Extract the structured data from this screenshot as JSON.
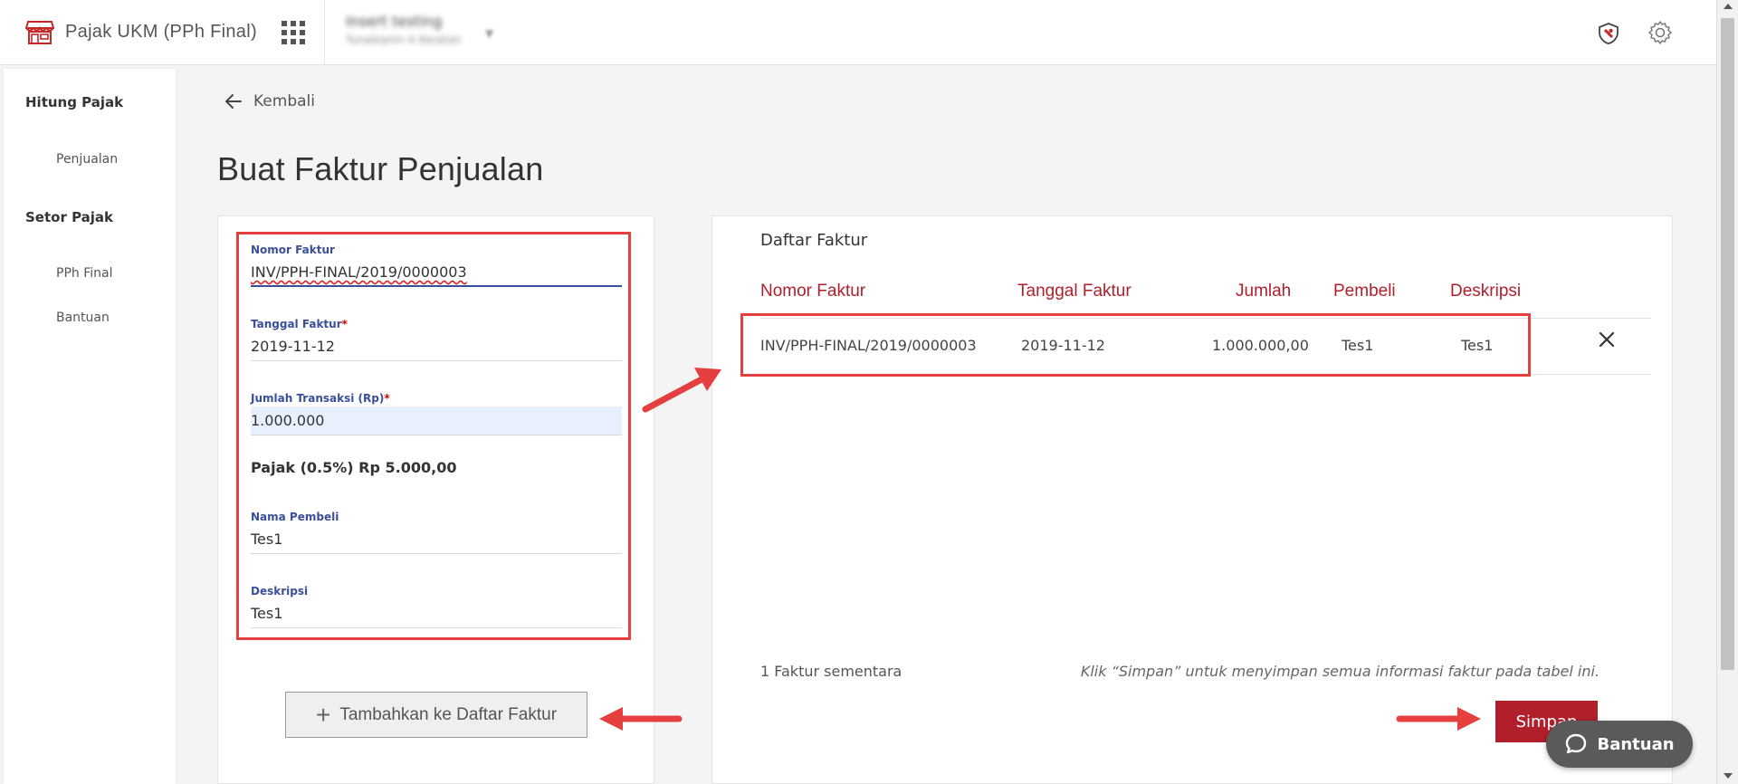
{
  "header": {
    "app_title": "Pajak UKM (PPh Final)",
    "user_name": "Insert testing",
    "user_sub": "Tunaikanm A Keraton"
  },
  "sidebar": {
    "sections": [
      {
        "title": "Hitung Pajak",
        "items": [
          "Penjualan"
        ]
      },
      {
        "title": "Setor Pajak",
        "items": [
          "PPh Final",
          "Bantuan"
        ]
      }
    ]
  },
  "nav": {
    "back_label": "Kembali"
  },
  "page_title": "Buat Faktur Penjualan",
  "form": {
    "nomor_faktur": {
      "label": "Nomor Faktur",
      "value": "INV/PPH-FINAL/2019/0000003"
    },
    "tanggal_faktur": {
      "label": "Tanggal Faktur",
      "required": "*",
      "value": "2019-11-12"
    },
    "jumlah_transaksi": {
      "label": "Jumlah Transaksi (Rp)",
      "required": "*",
      "value": "1.000.000"
    },
    "tax_line": "Pajak (0.5%) Rp 5.000,00",
    "nama_pembeli": {
      "label": "Nama Pembeli",
      "value": "Tes1"
    },
    "deskripsi": {
      "label": "Deskripsi",
      "value": "Tes1"
    },
    "add_button_label": "Tambahkan ke Daftar Faktur"
  },
  "invoice_list": {
    "title": "Daftar Faktur",
    "columns": [
      "Nomor Faktur",
      "Tanggal Faktur",
      "Jumlah",
      "Pembeli",
      "Deskripsi"
    ],
    "rows": [
      [
        "INV/PPH-FINAL/2019/0000003",
        "2019-11-12",
        "1.000.000,00",
        "Tes1",
        "Tes1"
      ]
    ],
    "count_text": "1 Faktur sementara",
    "hint_text": "Klik “Simpan” untuk menyimpan semua informasi faktur pada tabel ini.",
    "save_label": "Simpan"
  },
  "help_button_label": "Bantuan",
  "colors": {
    "accent_red": "#b01f2a",
    "label_blue": "#3a4f9a",
    "annotation_red": "#e53f3f"
  },
  "icons": [
    "store-logo-icon",
    "apps-grid-icon",
    "shield-icon",
    "gear-icon",
    "arrow-left-icon",
    "plus-icon",
    "close-icon",
    "chat-icon"
  ]
}
